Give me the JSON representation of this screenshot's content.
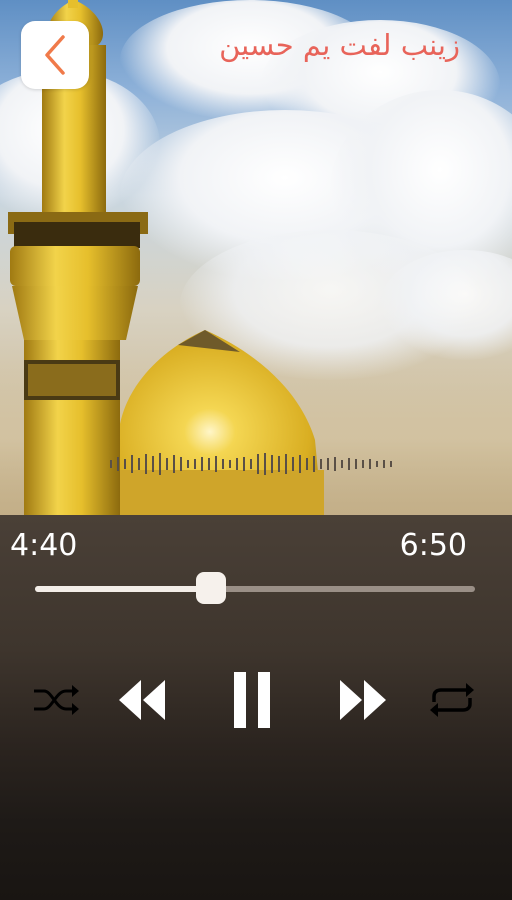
{
  "header": {
    "title": "زینب لفت یم حسین"
  },
  "player": {
    "elapsed": "4:40",
    "duration": "6:50",
    "progress_fraction": 0.4,
    "state": "playing"
  },
  "controls": {
    "shuffle": "shuffle-icon",
    "previous": "rewind-icon",
    "play_pause": "pause-icon",
    "next": "fast-forward-icon",
    "repeat": "repeat-icon"
  },
  "colors": {
    "title": "#e8645a",
    "accent": "#f3ede8",
    "back_chevron": "#f07a4a",
    "panel": "#3e352d"
  }
}
